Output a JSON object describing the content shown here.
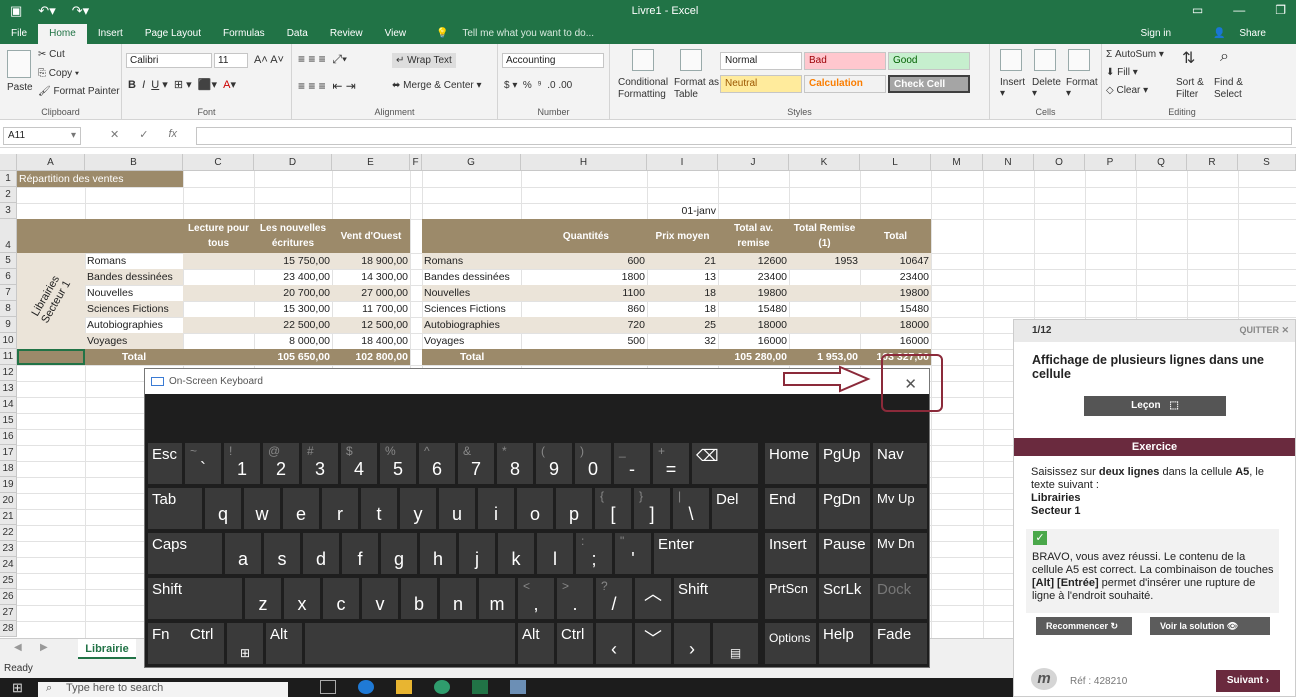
{
  "window": {
    "title": "Livre1 - Excel",
    "accent": "#217346"
  },
  "tabs": [
    "File",
    "Home",
    "Insert",
    "Page Layout",
    "Formulas",
    "Data",
    "Review",
    "View"
  ],
  "tell_me": "Tell me what you want to do...",
  "sign_in": "Sign in",
  "share": "Share",
  "ribbon": {
    "clipboard": {
      "paste": "Paste",
      "cut": "Cut",
      "copy": "Copy",
      "format_painter": "Format Painter",
      "label": "Clipboard"
    },
    "font": {
      "name": "Calibri",
      "size": "11",
      "label": "Font"
    },
    "alignment": {
      "wrap": "Wrap Text",
      "merge": "Merge & Center",
      "label": "Alignment"
    },
    "number": {
      "format": "Accounting",
      "label": "Number"
    },
    "styles": {
      "conditional": "Conditional Formatting",
      "format_table": "Format as Table",
      "normal": "Normal",
      "bad": "Bad",
      "good": "Good",
      "neutral": "Neutral",
      "calculation": "Calculation",
      "check_cell": "Check Cell",
      "label": "Styles"
    },
    "cells": {
      "insert": "Insert",
      "delete": "Delete",
      "format": "Format",
      "label": "Cells"
    },
    "editing": {
      "autosum": "AutoSum",
      "fill": "Fill",
      "clear": "Clear",
      "sort": "Sort & Filter",
      "find": "Find & Select",
      "label": "Editing"
    }
  },
  "formula_bar": {
    "name_box": "A11",
    "fx": "fx"
  },
  "columns": [
    "A",
    "B",
    "C",
    "D",
    "E",
    "F",
    "G",
    "H",
    "I",
    "J",
    "K",
    "L",
    "M",
    "N",
    "O",
    "P",
    "Q",
    "R",
    "S"
  ],
  "rows": [
    "1",
    "2",
    "3",
    "4",
    "5",
    "6",
    "7",
    "8",
    "9",
    "10",
    "11",
    "12",
    "13",
    "14",
    "15",
    "16",
    "17",
    "18",
    "19",
    "20",
    "21",
    "22",
    "23",
    "24",
    "25",
    "26",
    "27",
    "28"
  ],
  "sheet": {
    "a1": "Répartition des ventes",
    "i3": "01-janv",
    "vertical_label_1": "Librairies",
    "vertical_label_2": "Secteur 1",
    "left_headers": [
      "Lecture pour tous",
      "Les nouvelles écritures",
      "Vent d'Ouest"
    ],
    "left_rows": [
      {
        "name": "Romans",
        "c": "",
        "d": "15 750,00",
        "e": "18 900,00"
      },
      {
        "name": "Bandes dessinées",
        "c": "",
        "d": "23 400,00",
        "e": "14 300,00"
      },
      {
        "name": "Nouvelles",
        "c": "",
        "d": "20 700,00",
        "e": "27 000,00"
      },
      {
        "name": "Sciences Fictions",
        "c": "",
        "d": "15 300,00",
        "e": "11 700,00"
      },
      {
        "name": "Autobiographies",
        "c": "",
        "d": "22 500,00",
        "e": "12 500,00"
      },
      {
        "name": "Voyages",
        "c": "",
        "d": "8 000,00",
        "e": "18 400,00"
      }
    ],
    "left_total": {
      "label": "Total",
      "d": "105 650,00",
      "e": "102 800,00"
    },
    "right_headers": [
      "Quantités",
      "Prix moyen",
      "Total av. remise",
      "Total Remise (1)",
      "Total"
    ],
    "right_rows": [
      {
        "name": "Romans",
        "q": "600",
        "p": "21",
        "t": "12600",
        "r": "1953",
        "tot": "10647"
      },
      {
        "name": "Bandes dessinées",
        "q": "1800",
        "p": "13",
        "t": "23400",
        "r": "",
        "tot": "23400"
      },
      {
        "name": "Nouvelles",
        "q": "1100",
        "p": "18",
        "t": "19800",
        "r": "",
        "tot": "19800"
      },
      {
        "name": "Sciences Fictions",
        "q": "860",
        "p": "18",
        "t": "15480",
        "r": "",
        "tot": "15480"
      },
      {
        "name": "Autobiographies",
        "q": "720",
        "p": "25",
        "t": "18000",
        "r": "",
        "tot": "18000"
      },
      {
        "name": "Voyages",
        "q": "500",
        "p": "32",
        "t": "16000",
        "r": "",
        "tot": "16000"
      }
    ],
    "right_total": {
      "label": "Total",
      "t": "105 280,00",
      "r": "1 953,00",
      "tot": "103 327,00"
    }
  },
  "sheet_tab": "Librairie",
  "status": "Ready",
  "taskbar": {
    "search": "Type here to search"
  },
  "osk": {
    "title": "On-Screen Keyboard",
    "close": "✕"
  },
  "panel": {
    "step": "1/12",
    "quit": "QUITTER ✕",
    "title": "Affichage de plusieurs lignes dans une cellule",
    "lecon": "Leçon",
    "exercice": "Exercice",
    "instr_1": "Saisissez sur ",
    "instr_bold": "deux lignes",
    "instr_2": " dans la cellule ",
    "instr_cell": "A5",
    "instr_3": ", le texte suivant :",
    "instr_line1": "Librairies",
    "instr_line2": "Secteur 1",
    "fb_1": "BRAVO, vous avez réussi. Le contenu de la cellule A5 est correct. La combinaison de touches ",
    "fb_keys": "[Alt] [Entrée]",
    "fb_2": " permet d'insérer une rupture de ligne à l'endroit souhaité.",
    "recommencer": "Recommencer",
    "voir_solution": "Voir la solution",
    "logo": "m",
    "ref": "Réf : 428210",
    "suivant": "Suivant ›"
  }
}
